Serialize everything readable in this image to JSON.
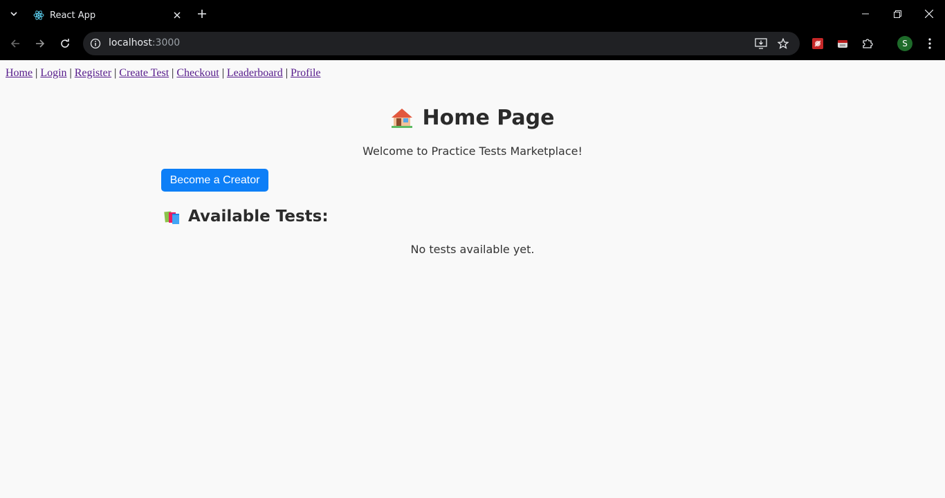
{
  "browser": {
    "tab_title": "React App",
    "url_host": "localhost",
    "url_port": ":3000",
    "profile_initial": "S",
    "icons": [
      "tab-search-icon",
      "react-favicon-icon",
      "close-icon",
      "plus-icon",
      "minimize-icon",
      "restore-icon",
      "close-window-icon",
      "back-arrow-icon",
      "forward-arrow-icon",
      "reload-icon",
      "info-icon",
      "install-app-icon",
      "star-icon",
      "extension-icon",
      "puzzle-icon",
      "more-vert-icon"
    ]
  },
  "nav": {
    "links": [
      "Home",
      "Login",
      "Register",
      "Create Test",
      "Checkout",
      "Leaderboard",
      "Profile"
    ],
    "separator": "|"
  },
  "main": {
    "title_emoji": "🏠",
    "title": "Home Page",
    "welcome": "Welcome to Practice Tests Marketplace!",
    "creator_button": "Become a Creator",
    "tests_heading_emoji": "📚",
    "tests_heading": "Available Tests:",
    "empty_message": "No tests available yet."
  },
  "colors": {
    "accent_button": "#0d7ff7",
    "visited_link": "#551a8b",
    "page_bg": "#f9f9f9",
    "chrome_bg": "#000000"
  }
}
